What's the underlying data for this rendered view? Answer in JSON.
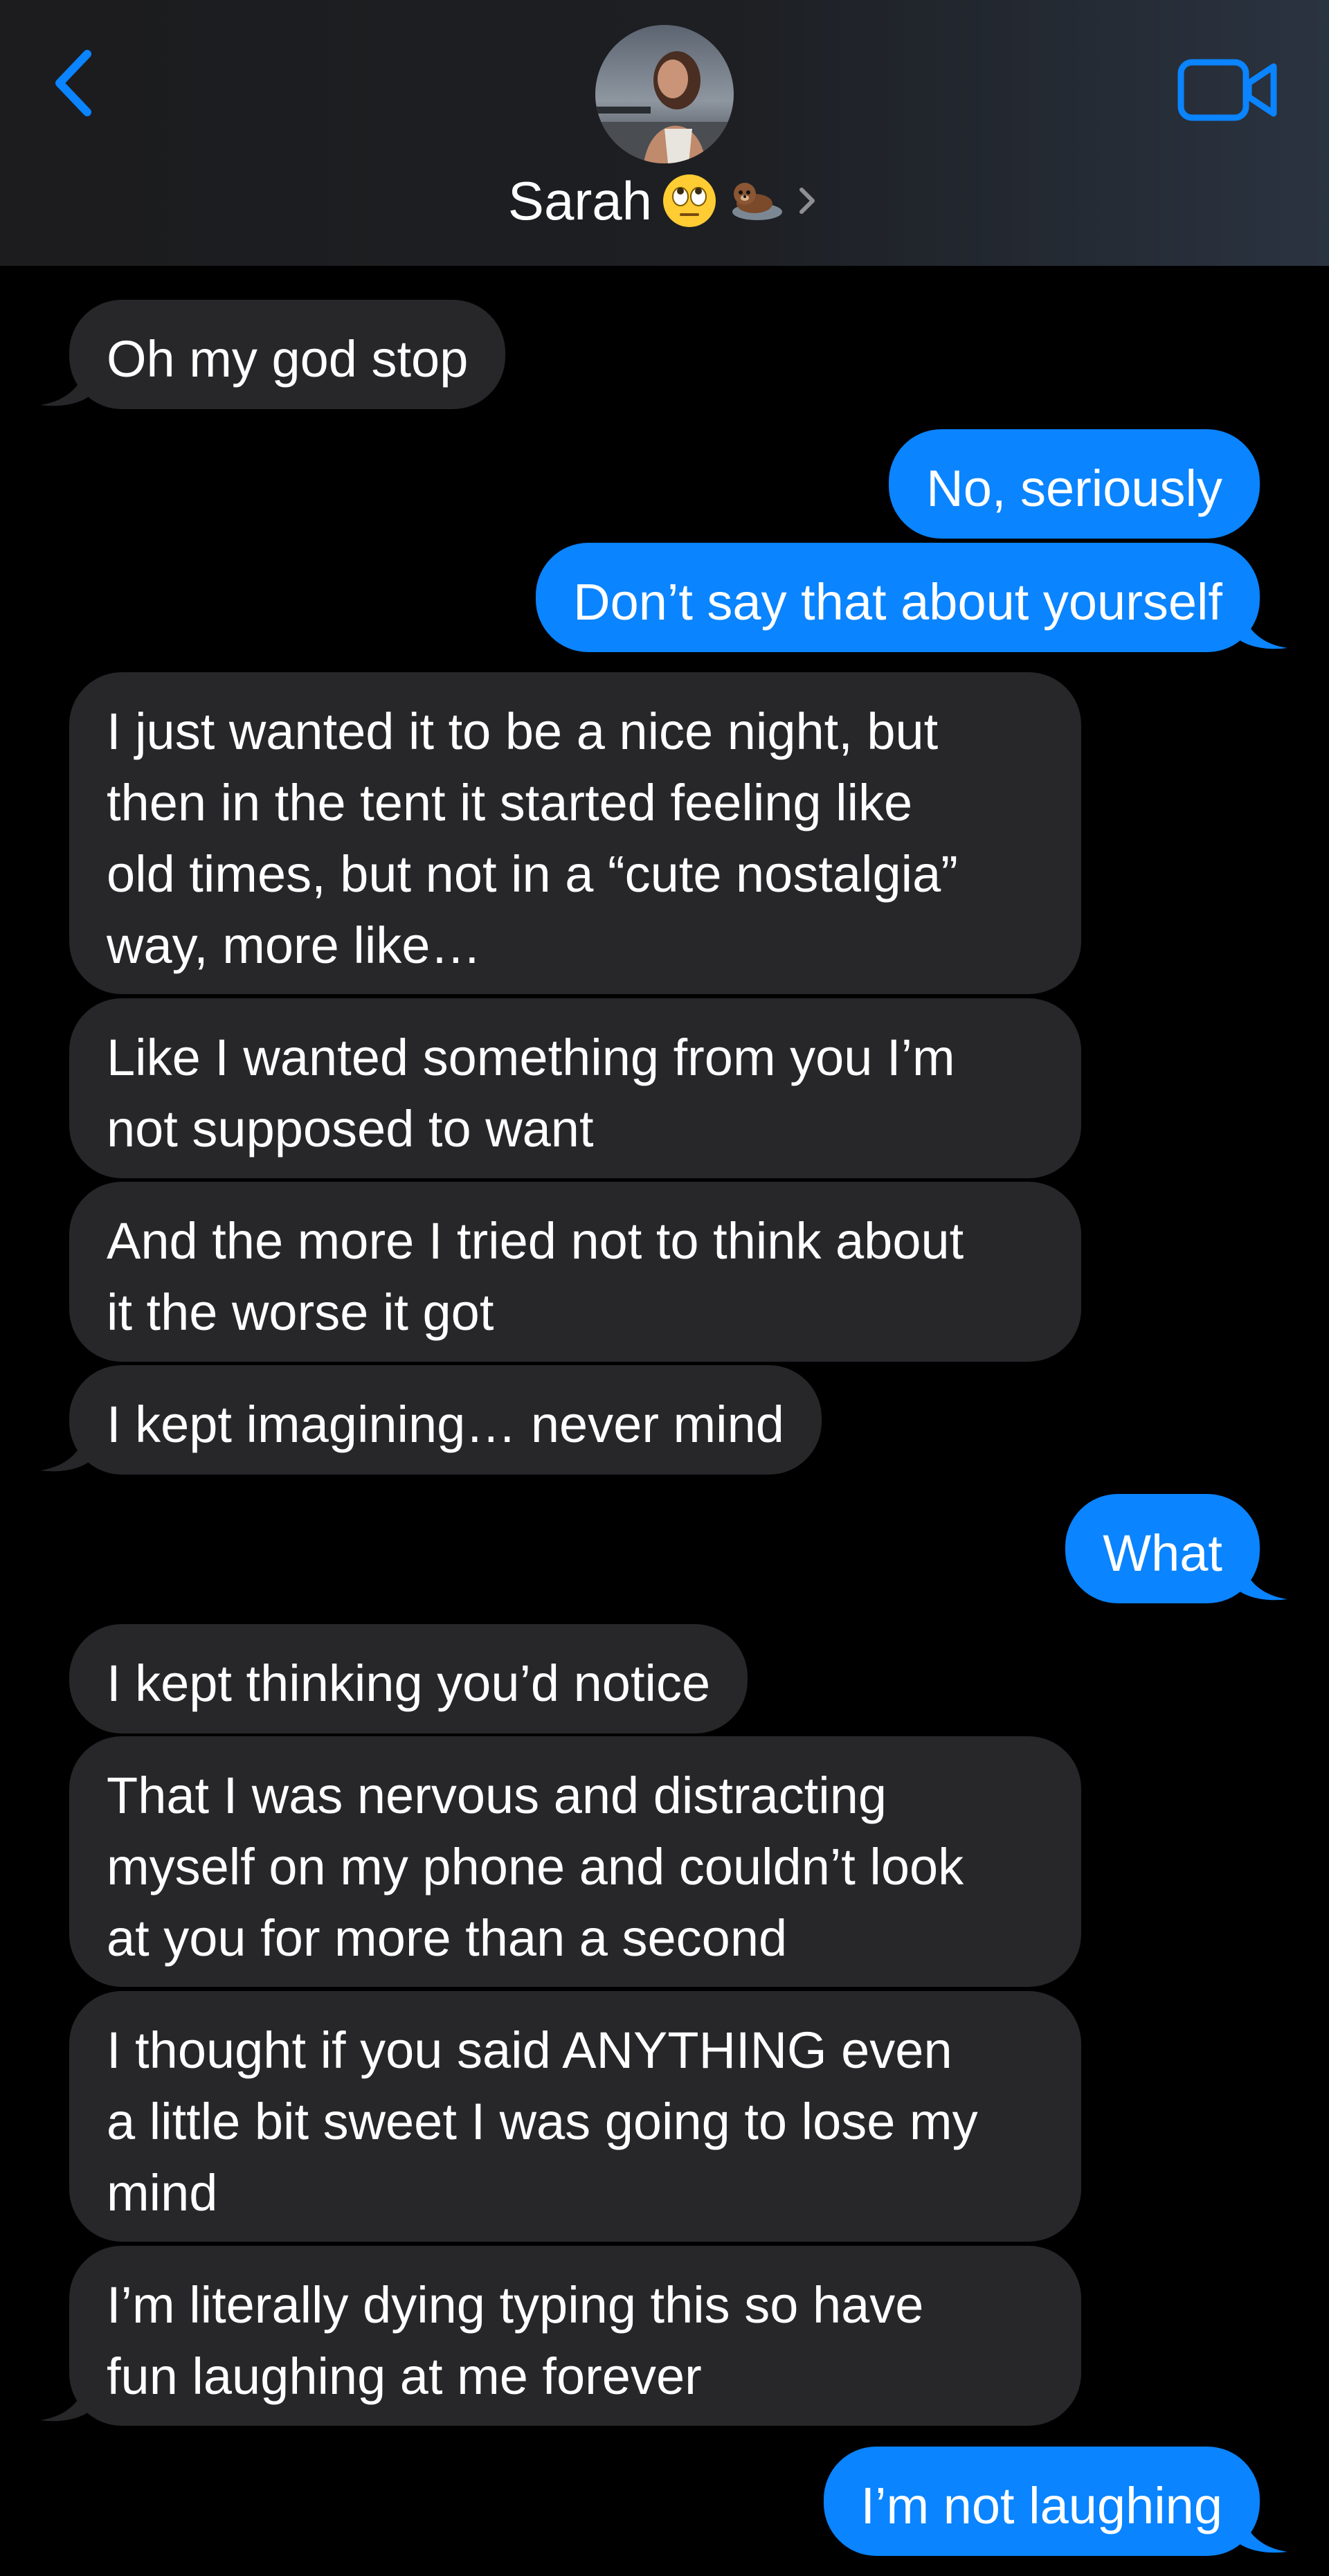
{
  "header": {
    "contact_name": "Sarah",
    "contact_emojis": [
      "face-with-rolling-eyes",
      "otter"
    ],
    "accent_color": "#0a84ff"
  },
  "messages": [
    {
      "from": "them",
      "text": [
        "Oh my god stop"
      ]
    },
    {
      "from": "me",
      "text": [
        "No, seriously"
      ]
    },
    {
      "from": "me",
      "text": [
        "Don’t say that about yourself"
      ]
    },
    {
      "from": "them",
      "text": [
        "I just wanted it to be a nice night, but",
        "then in the tent it started feeling like",
        "old times, but not in a “cute nostalgia”",
        "way, more like…"
      ]
    },
    {
      "from": "them",
      "text": [
        "Like I wanted something from you I’m",
        "not supposed to want"
      ]
    },
    {
      "from": "them",
      "text": [
        "And the more I tried not to think about",
        "it the worse it got"
      ]
    },
    {
      "from": "them",
      "text": [
        "I kept imagining… never mind"
      ]
    },
    {
      "from": "me",
      "text": [
        "What"
      ]
    },
    {
      "from": "them",
      "text": [
        "I kept thinking you’d notice"
      ]
    },
    {
      "from": "them",
      "text": [
        "That I was nervous and distracting",
        "myself on my phone and couldn’t look",
        "at you for more than a second"
      ]
    },
    {
      "from": "them",
      "text": [
        "I thought if you said ANYTHING even",
        "a little bit sweet I was going to lose my",
        "mind"
      ]
    },
    {
      "from": "them",
      "text": [
        "I’m literally dying typing this so have",
        "fun laughing at me forever"
      ]
    },
    {
      "from": "me",
      "text": [
        "I’m not laughing"
      ]
    }
  ]
}
